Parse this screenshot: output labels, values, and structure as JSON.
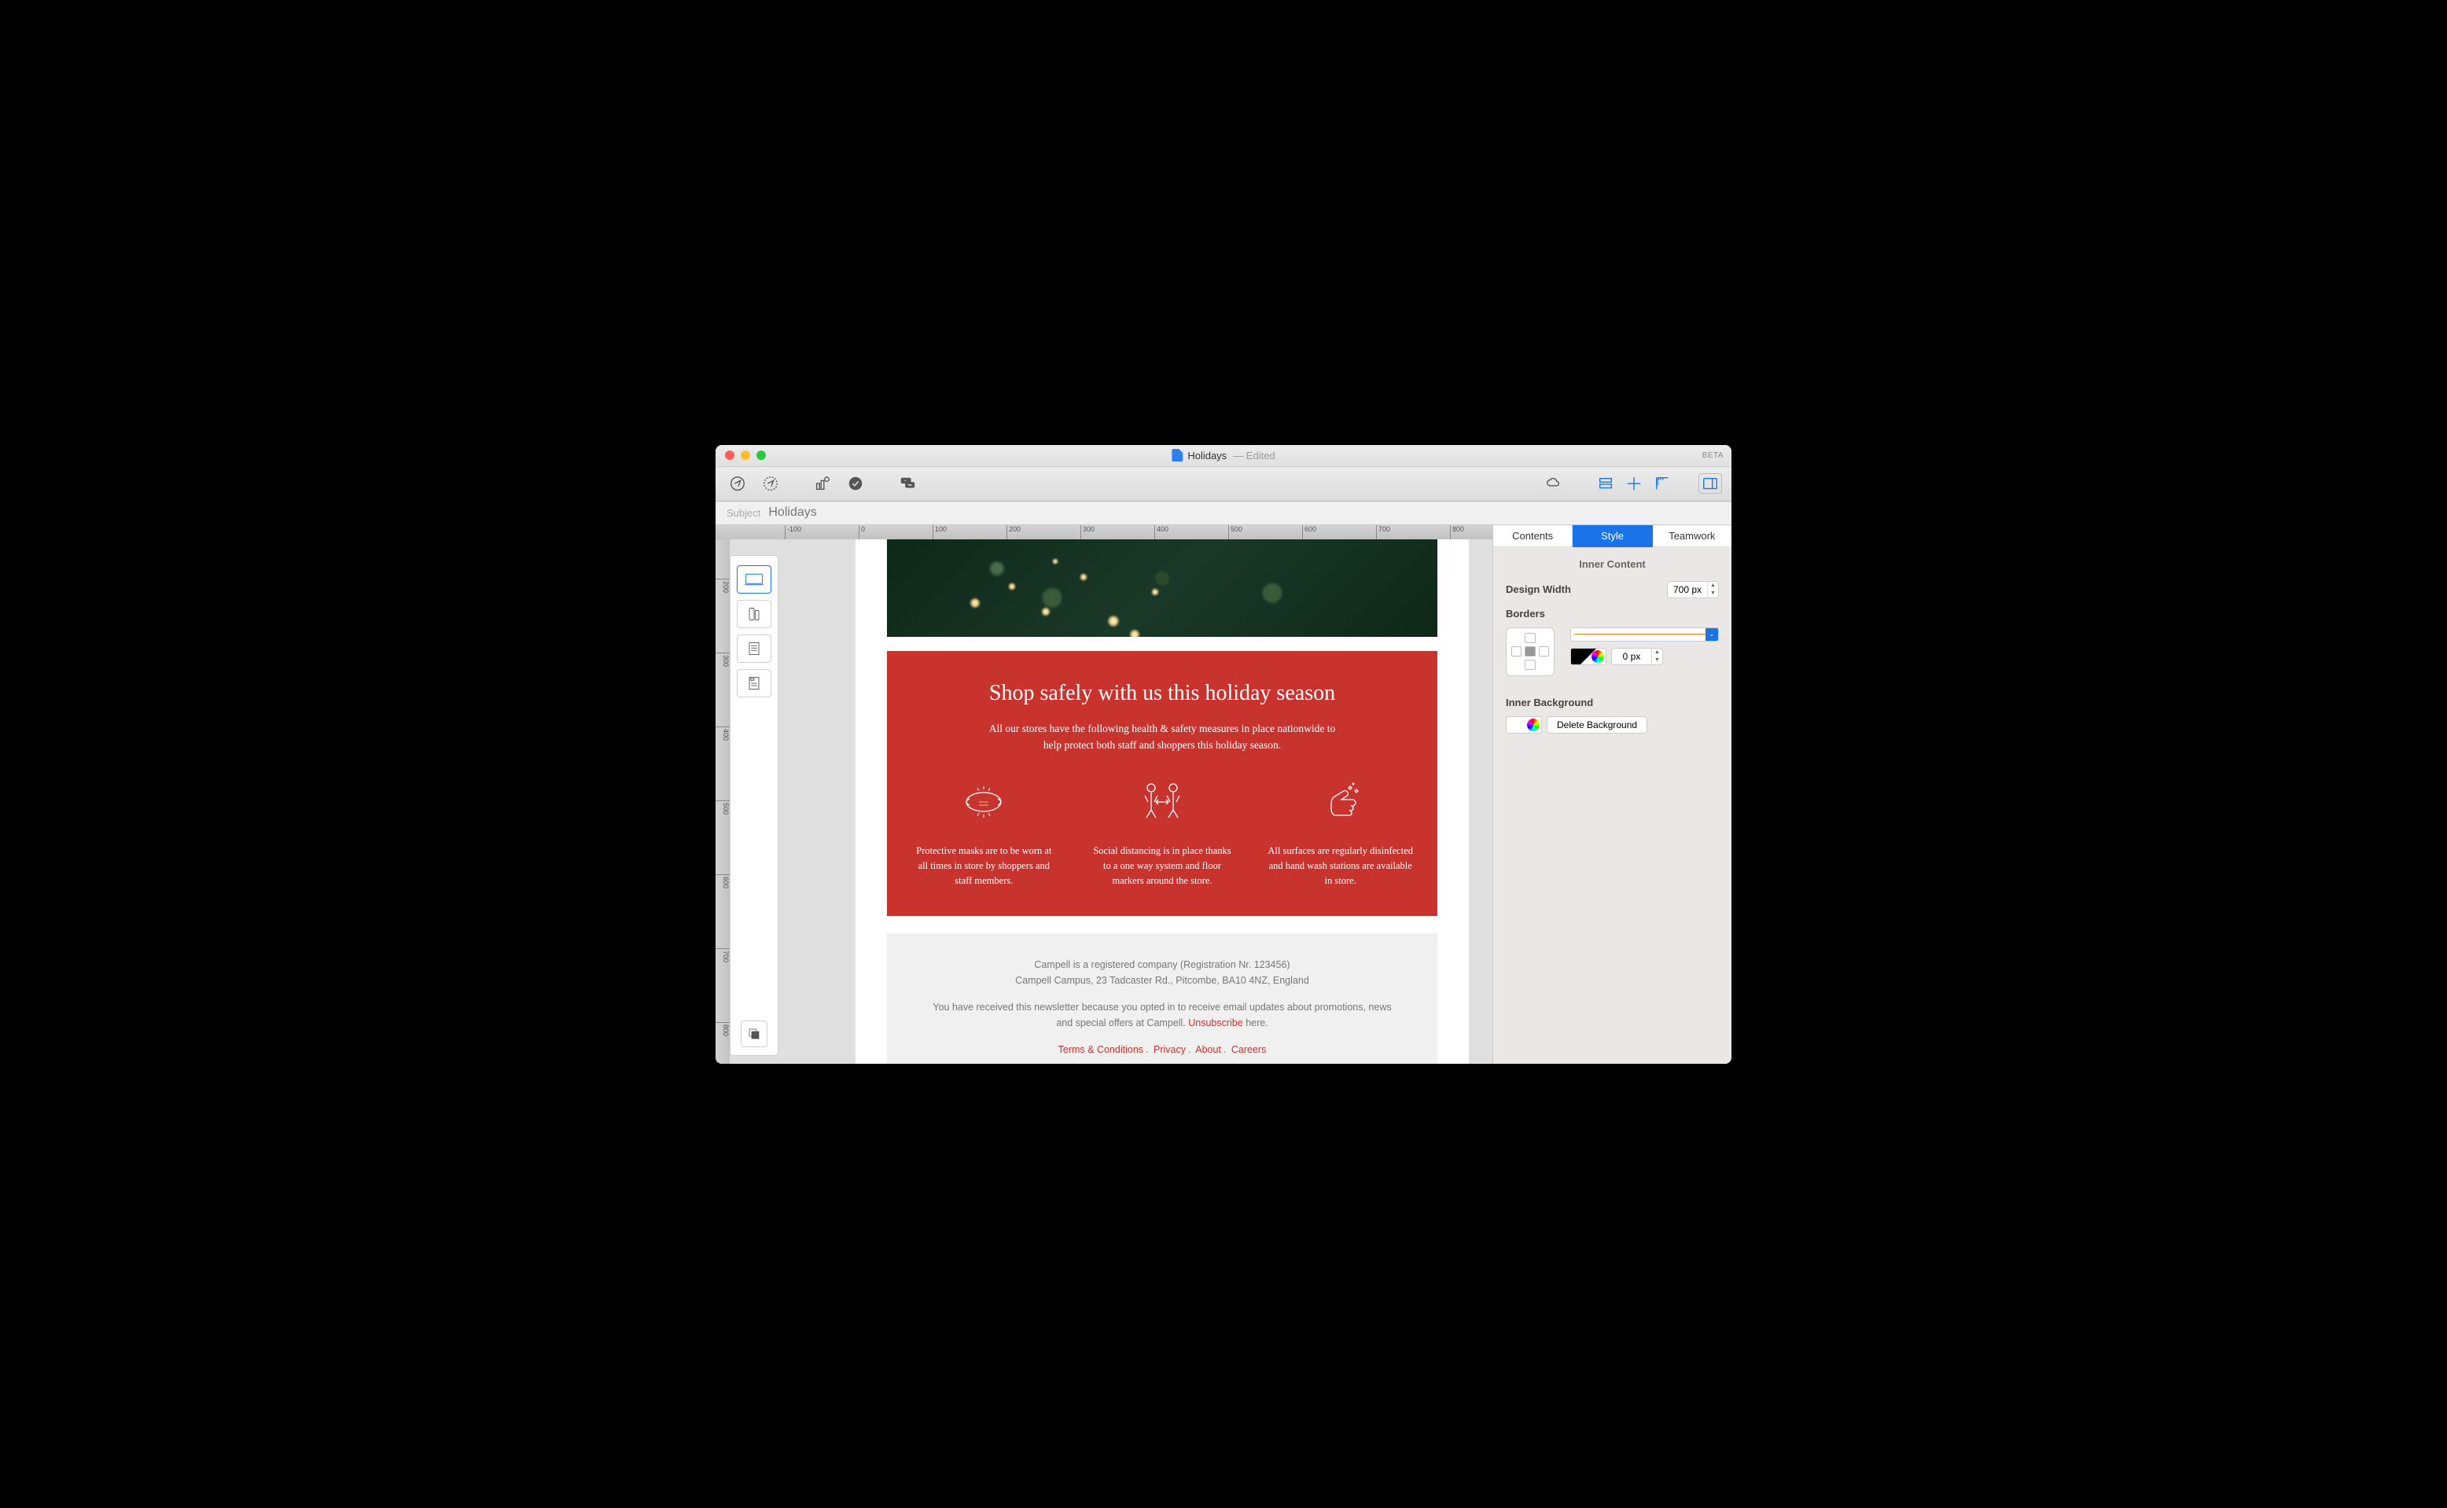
{
  "window": {
    "filename": "Holidays",
    "edited": "— Edited",
    "beta": "BETA"
  },
  "subject": {
    "label": "Subject",
    "value": "Holidays"
  },
  "ruler_h": [
    "-100",
    "0",
    "100",
    "200",
    "300",
    "400",
    "500",
    "600",
    "700",
    "800"
  ],
  "ruler_v": [
    "200",
    "300",
    "400",
    "500",
    "600",
    "700",
    "800"
  ],
  "tabs": {
    "contents": "Contents",
    "style": "Style",
    "teamwork": "Teamwork"
  },
  "inspector": {
    "inner_content_title": "Inner Content",
    "design_width_label": "Design Width",
    "design_width_value": "700 px",
    "borders_label": "Borders",
    "border_width_value": "0 px",
    "inner_bg_label": "Inner Background",
    "delete_bg_btn": "Delete Background"
  },
  "email": {
    "headline": "Shop safely with us this holiday season",
    "subtext": "All our stores have the following health & safety measures in place nationwide to help protect both staff and shoppers this holiday season.",
    "cols": [
      "Protective masks are to be worn at all times in store by shoppers and staff members.",
      "Social distancing is in place thanks to a one way system and floor markers around the store.",
      "All surfaces are regularly disinfected and hand wash stations are available in store."
    ],
    "footer_reg": "Campell is a registered company (Registration Nr. 123456)",
    "footer_addr": "Campell Campus, 23 Tadcaster Rd., Pitcombe, BA10 4NZ, England",
    "footer_optin": "You have received this newsletter because you opted in to receive email updates about promotions, news and special offers at Campell. ",
    "footer_unsub": "Unsubscribe",
    "footer_here": " here.",
    "links": {
      "terms": "Terms & Conditions",
      "privacy": "Privacy",
      "about": "About",
      "careers": "Careers"
    }
  }
}
